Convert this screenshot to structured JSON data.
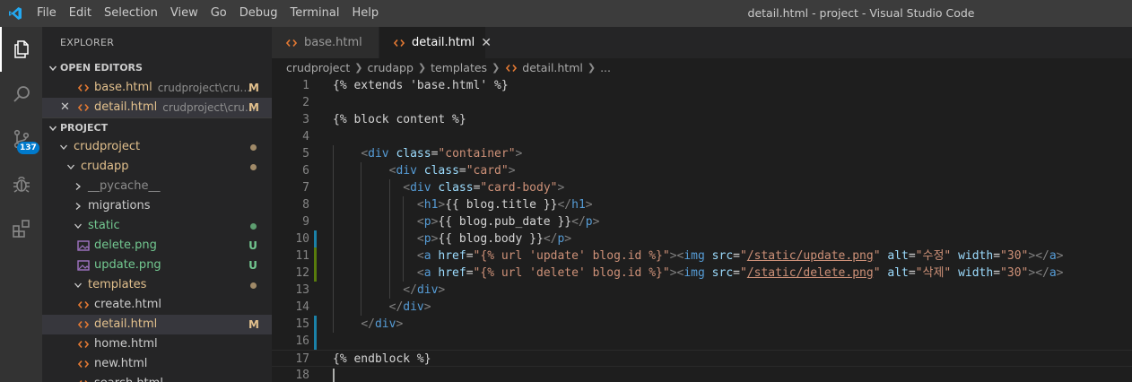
{
  "titlebar": {
    "menu": [
      "File",
      "Edit",
      "Selection",
      "View",
      "Go",
      "Debug",
      "Terminal",
      "Help"
    ],
    "window_title": "detail.html - project - Visual Studio Code"
  },
  "activitybar": {
    "items": [
      "explorer-icon",
      "search-icon",
      "source-control-icon",
      "debug-icon",
      "extensions-icon"
    ],
    "scm_badge": "137"
  },
  "sidebar": {
    "title": "EXPLORER",
    "open_editors": {
      "header": "OPEN EDITORS",
      "items": [
        {
          "name": "base.html",
          "path": "crudproject\\crudp...",
          "status": "M"
        },
        {
          "name": "detail.html",
          "path": "crudproject\\crud...",
          "status": "M"
        }
      ]
    },
    "project": {
      "header": "PROJECT",
      "tree": [
        {
          "name": "crudproject",
          "status": "dot"
        },
        {
          "name": "crudapp",
          "status": "dot"
        },
        {
          "name": "__pycache__",
          "status": ""
        },
        {
          "name": "migrations",
          "status": ""
        },
        {
          "name": "static",
          "status": "dot"
        },
        {
          "name": "delete.png",
          "status": "U"
        },
        {
          "name": "update.png",
          "status": "U"
        },
        {
          "name": "templates",
          "status": "dot"
        },
        {
          "name": "create.html",
          "status": ""
        },
        {
          "name": "detail.html",
          "status": "M"
        },
        {
          "name": "home.html",
          "status": ""
        },
        {
          "name": "new.html",
          "status": ""
        },
        {
          "name": "search.html",
          "status": ""
        }
      ]
    }
  },
  "tabs": [
    {
      "label": "base.html",
      "active": false
    },
    {
      "label": "detail.html",
      "active": true
    }
  ],
  "breadcrumb": [
    "crudproject",
    "crudapp",
    "templates",
    "detail.html",
    "..."
  ],
  "editor": {
    "line_numbers": [
      "1",
      "2",
      "3",
      "4",
      "5",
      "6",
      "7",
      "8",
      "9",
      "10",
      "11",
      "12",
      "13",
      "14",
      "15",
      "16",
      "17",
      "18"
    ],
    "lines": [
      "{% extends 'base.html' %}",
      "",
      "{% block content %}",
      "",
      "    <div class=\"container\">",
      "        <div class=\"card\">",
      "          <div class=\"card-body\">",
      "            <h1>{{ blog.title }}</h1>",
      "            <p>{{ blog.pub_date }}</p>",
      "            <p>{{ blog.body }}</p>",
      "            <a href=\"{% url 'update' blog.id %}\"><img src=\"/static/update.png\" alt=\"수정\" width=\"30\"></a>",
      "            <a href=\"{% url 'delete' blog.id %}\"><img src=\"/static/delete.png\" alt=\"삭제\" width=\"30\"></a>",
      "          </div>",
      "        </div>",
      "    </div>",
      "",
      "{% endblock %}",
      ""
    ]
  },
  "colors": {
    "accent": "#007acc",
    "modified": "#e2c08d",
    "untracked": "#73c991",
    "gutter_modified": "#1b81a8",
    "gutter_added": "#587c0c"
  }
}
